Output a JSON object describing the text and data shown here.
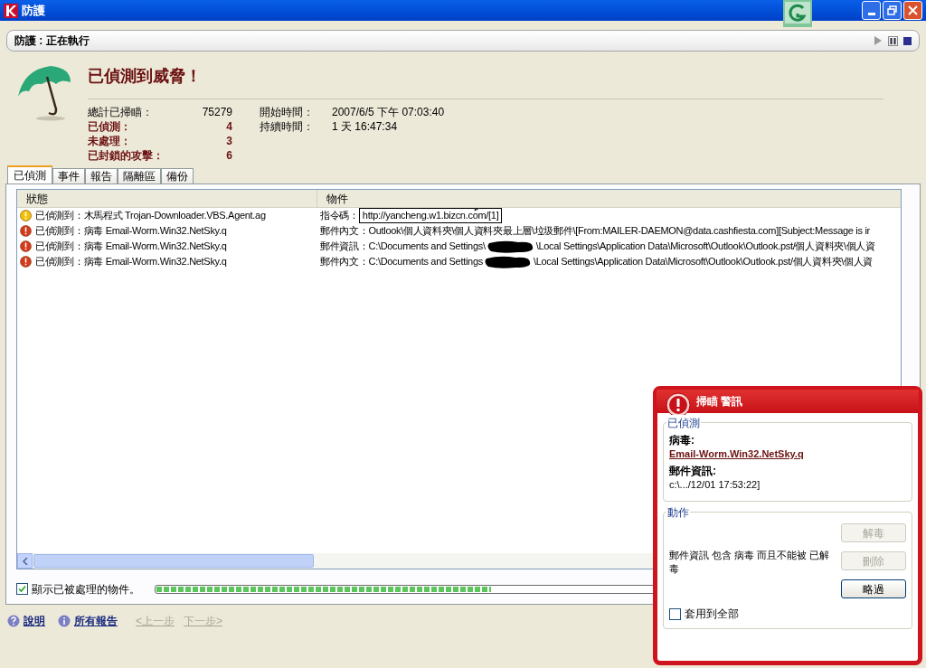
{
  "window": {
    "title": "防護"
  },
  "status": {
    "text": "防護 : 正在執行"
  },
  "header": {
    "title": "已偵測到威脅！"
  },
  "stats": {
    "left": [
      {
        "label": "總計已掃瞄：",
        "value": "75279",
        "alert": false
      },
      {
        "label": "已偵測：",
        "value": "4",
        "alert": true
      },
      {
        "label": "未處理：",
        "value": "3",
        "alert": true
      },
      {
        "label": "已封鎖的攻擊：",
        "value": "6",
        "alert": true
      }
    ],
    "right": [
      {
        "label": "開始時間：",
        "value": "2007/6/5 下午 07:03:40"
      },
      {
        "label": "持續時間：",
        "value": "1 天 16:47:34"
      }
    ]
  },
  "tabs": [
    {
      "label": "已偵測",
      "selected": true
    },
    {
      "label": "事件",
      "selected": false
    },
    {
      "label": "報告",
      "selected": false
    },
    {
      "label": "隔離區",
      "selected": false
    },
    {
      "label": "備份",
      "selected": false
    }
  ],
  "table": {
    "columns": [
      "狀態",
      "物件"
    ],
    "rows": [
      {
        "kind": "warning",
        "status": "已偵測到：木馬程式 Trojan-Downloader.VBS.Agent.ag",
        "object_parts": [
          {
            "kind": "text",
            "text": "指令碼："
          },
          {
            "kind": "boxed",
            "text": "http://yancheng.w1.bizcn.com/[1]"
          }
        ]
      },
      {
        "kind": "danger",
        "status": "已偵測到：病毒 Email-Worm.Win32.NetSky.q",
        "object_parts": [
          {
            "kind": "text",
            "text": "郵件內文：Outlook\\個人資料夾\\個人資料夾最上層\\垃圾郵件\\[From:MAILER-DAEMON@data.cashfiesta.com][Subject:Message is ir"
          }
        ]
      },
      {
        "kind": "danger",
        "status": "已偵測到：病毒 Email-Worm.Win32.NetSky.q",
        "object_parts": [
          {
            "kind": "text",
            "text": "郵件資訊：C:\\Documents and Settings\\"
          },
          {
            "kind": "redacted"
          },
          {
            "kind": "text",
            "text": "\\Local Settings\\Application Data\\Microsoft\\Outlook\\Outlook.pst/個人資料夾\\個人資"
          }
        ]
      },
      {
        "kind": "danger",
        "status": "已偵測到：病毒 Email-Worm.Win32.NetSky.q",
        "object_parts": [
          {
            "kind": "text",
            "text": "郵件內文：C:\\Documents and Settings"
          },
          {
            "kind": "redacted"
          },
          {
            "kind": "text",
            "text": "\\Local Settings\\Application Data\\Microsoft\\Outlook\\Outlook.pst/個人資料夾\\個人資"
          }
        ]
      }
    ]
  },
  "show_processed": {
    "label": "顯示已被處理的物件。",
    "checked": true
  },
  "progress": {
    "level": 0.45
  },
  "footer": {
    "links": [
      {
        "kind": "help",
        "label": "說明"
      },
      {
        "kind": "info",
        "label": "所有報告"
      }
    ],
    "nav": [
      {
        "label": "<上一步",
        "disabled": true
      },
      {
        "label": "下一步>",
        "disabled": true
      }
    ]
  },
  "popup": {
    "title": "掃瞄 警訊",
    "detected_group": "已偵測",
    "fields": [
      {
        "label": "病毒:",
        "value": "Email-Worm.Win32.NetSky.q",
        "link": true
      },
      {
        "label": "郵件資訊:",
        "value": "c:\\.../12/01 17:53:22]",
        "link": false
      }
    ],
    "action_group": "動作",
    "message": "郵件資訊 包含 病毒 而且不能被 已解毒",
    "buttons": [
      {
        "label": "解毒",
        "disabled": true
      },
      {
        "label": "刪除",
        "disabled": true
      },
      {
        "label": "略過",
        "disabled": false
      }
    ],
    "apply_all": {
      "label": "套用到全部",
      "checked": false
    }
  }
}
